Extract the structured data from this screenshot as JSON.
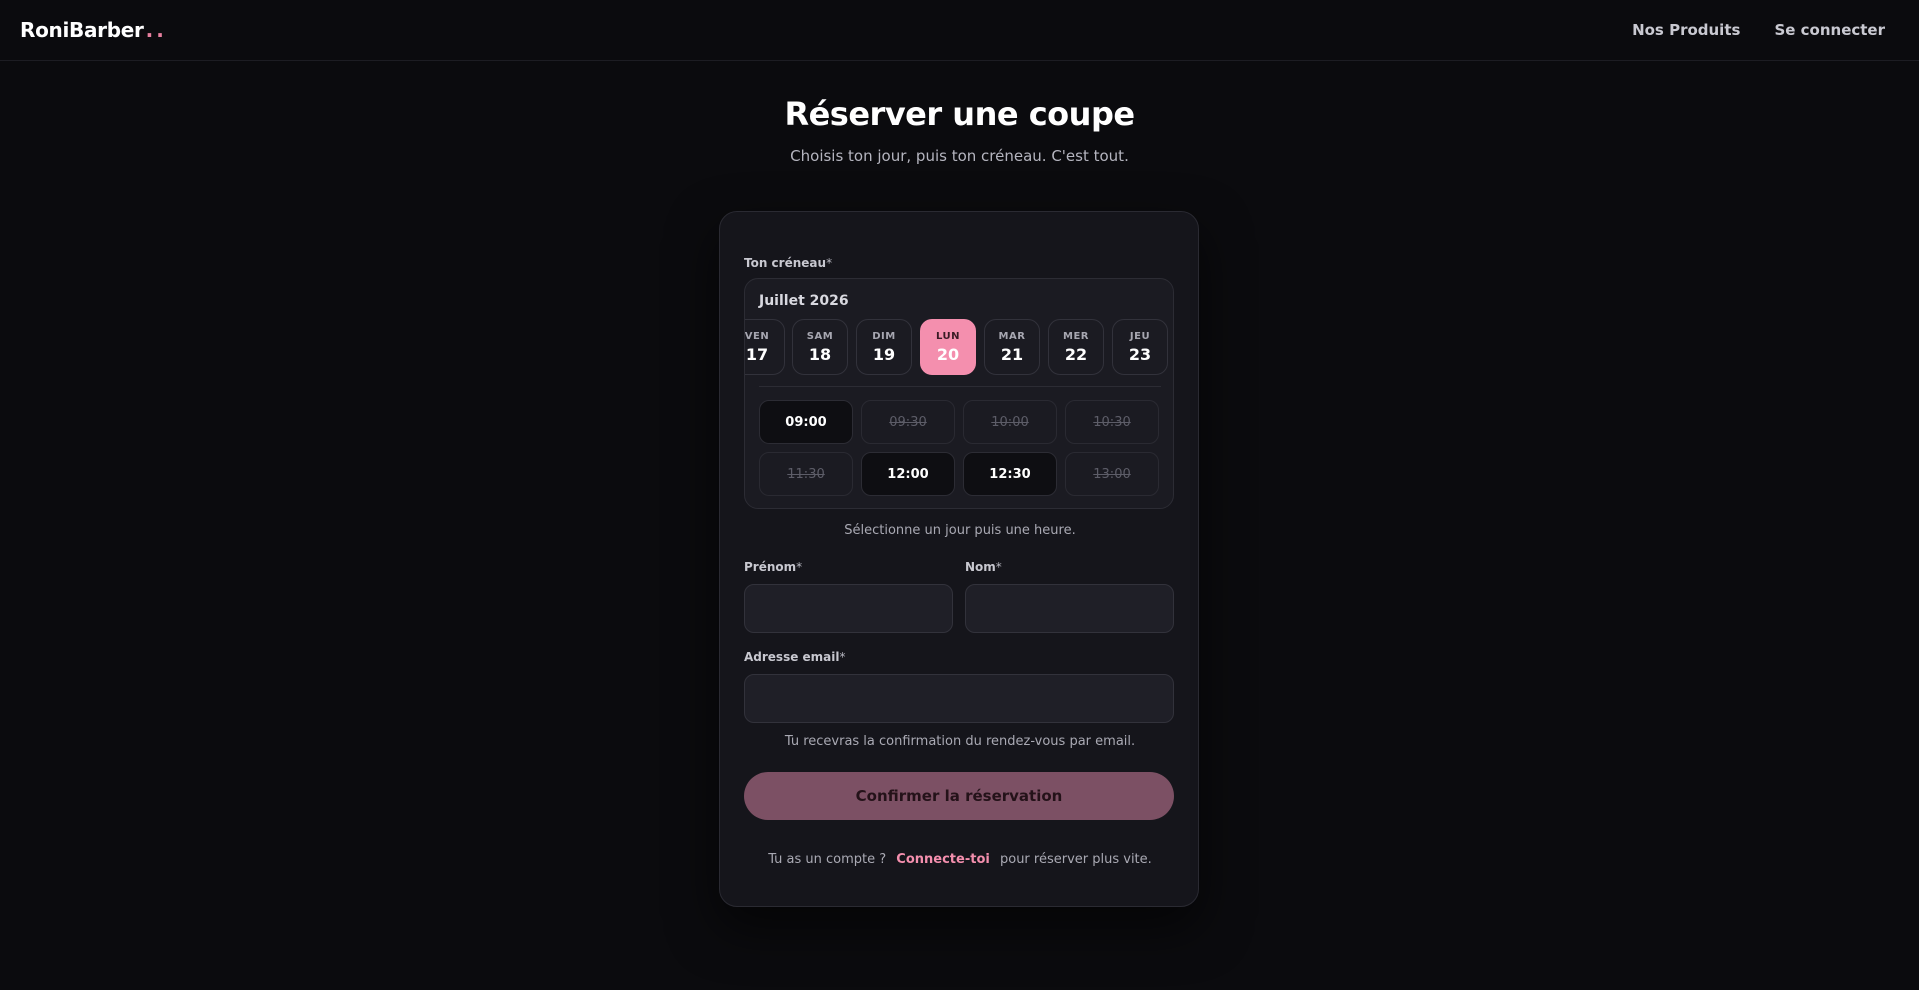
{
  "header": {
    "logo": "RoniBarber",
    "logo_dots": "..",
    "nav": [
      "Nos Produits",
      "Se connecter"
    ]
  },
  "page": {
    "title": "Réserver une coupe",
    "subtitle": "Choisis ton jour, puis ton créneau. C'est tout."
  },
  "booking": {
    "slot_label": "Ton créneau",
    "required_mark": "*",
    "month": "Juillet 2026",
    "days": [
      {
        "name": "VEN",
        "num": "17"
      },
      {
        "name": "SAM",
        "num": "18"
      },
      {
        "name": "DIM",
        "num": "19"
      },
      {
        "name": "LUN",
        "num": "20",
        "selected": true
      },
      {
        "name": "MAR",
        "num": "21"
      },
      {
        "name": "MER",
        "num": "22"
      },
      {
        "name": "JEU",
        "num": "23"
      }
    ],
    "times": [
      {
        "label": "09:00",
        "available": true
      },
      {
        "label": "09:30",
        "available": false
      },
      {
        "label": "10:00",
        "available": false
      },
      {
        "label": "10:30",
        "available": false
      },
      {
        "label": "11:30",
        "available": false
      },
      {
        "label": "12:00",
        "available": true
      },
      {
        "label": "12:30",
        "available": true
      },
      {
        "label": "13:00",
        "available": false
      }
    ],
    "slot_hint": "Sélectionne un jour puis une heure."
  },
  "form": {
    "firstname_label": "Prénom",
    "lastname_label": "Nom",
    "email_label": "Adresse email",
    "email_hint": "Tu recevras la confirmation du rendez-vous par email.",
    "submit_label": "Confirmer la réservation",
    "account_prefix": "Tu as un compte ?",
    "account_link": "Connecte-toi",
    "account_suffix": "pour réserver plus vite."
  },
  "colors": {
    "accent": "#f48fae",
    "button": "#7c5064",
    "background": "#0b0b0e",
    "card": "#15151b"
  }
}
